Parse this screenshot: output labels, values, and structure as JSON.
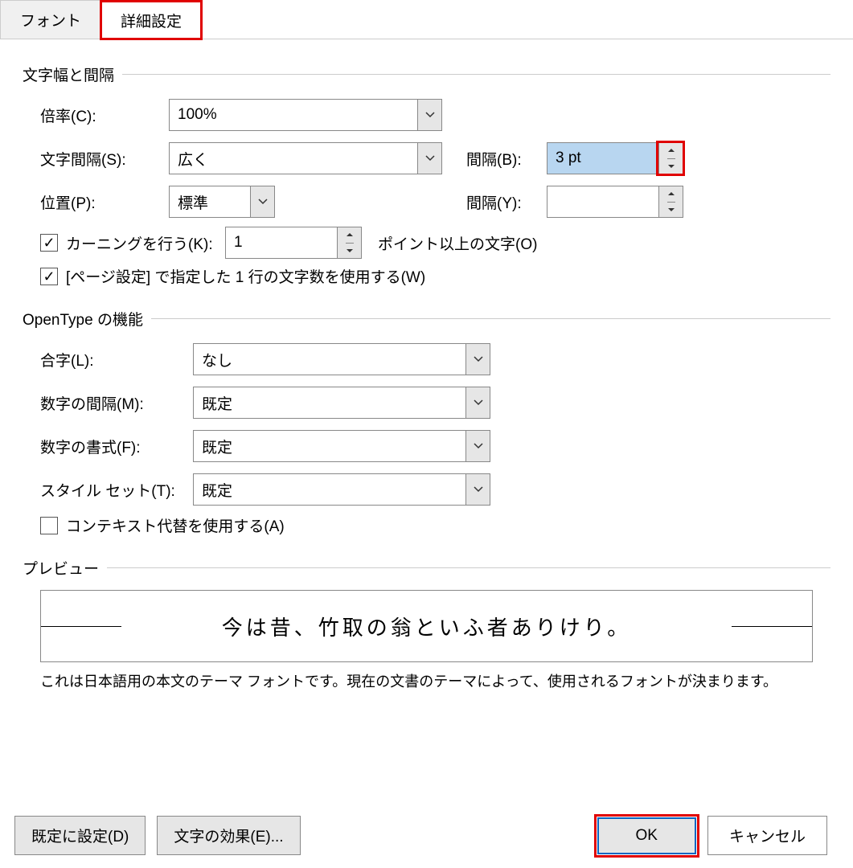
{
  "tabs": {
    "font": "フォント",
    "advanced": "詳細設定"
  },
  "g1": {
    "title": "文字幅と間隔",
    "scale_label": "倍率(C):",
    "scale_value": "100%",
    "spacing_label": "文字間隔(S):",
    "spacing_value": "広く",
    "by_label_b": "間隔(B):",
    "by_value_b": "3 pt",
    "pos_label": "位置(P):",
    "pos_value": "標準",
    "by_label_y": "間隔(Y):",
    "by_value_y": "",
    "kern_chk": "カーニングを行う(K):",
    "kern_value": "1",
    "kern_after": "ポイント以上の文字(O)",
    "grid_chk": "[ページ設定] で指定した 1 行の文字数を使用する(W)"
  },
  "g2": {
    "title": "OpenType の機能",
    "lig_label": "合字(L):",
    "lig_value": "なし",
    "numsp_label": "数字の間隔(M):",
    "numsp_value": "既定",
    "numfm_label": "数字の書式(F):",
    "numfm_value": "既定",
    "sset_label": "スタイル セット(T):",
    "sset_value": "既定",
    "ctx_chk": "コンテキスト代替を使用する(A)"
  },
  "preview": {
    "title": "プレビュー",
    "sample": "今は昔、竹取の翁といふ者ありけり。",
    "desc": "これは日本語用の本文のテーマ フォントです。現在の文書のテーマによって、使用されるフォントが決まります。"
  },
  "footer": {
    "default": "既定に設定(D)",
    "effects": "文字の効果(E)...",
    "ok": "OK",
    "cancel": "キャンセル"
  }
}
